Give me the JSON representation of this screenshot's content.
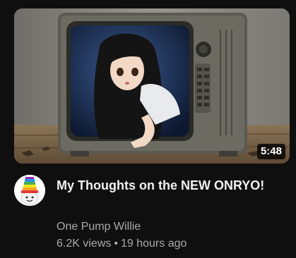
{
  "video": {
    "duration": "5:48",
    "title": "My Thoughts on the NEW ONRYO!",
    "channel": "One Pump Willie",
    "views": "6.2K views",
    "separator": "•",
    "age": "19 hours ago"
  },
  "colors": {
    "background": "#0f0f0f",
    "title": "#f1f1f1",
    "secondary_text": "#aaaaaa",
    "duration_badge": "#000000"
  },
  "icons": {
    "avatar": "rainbow-hat-character-avatar"
  }
}
